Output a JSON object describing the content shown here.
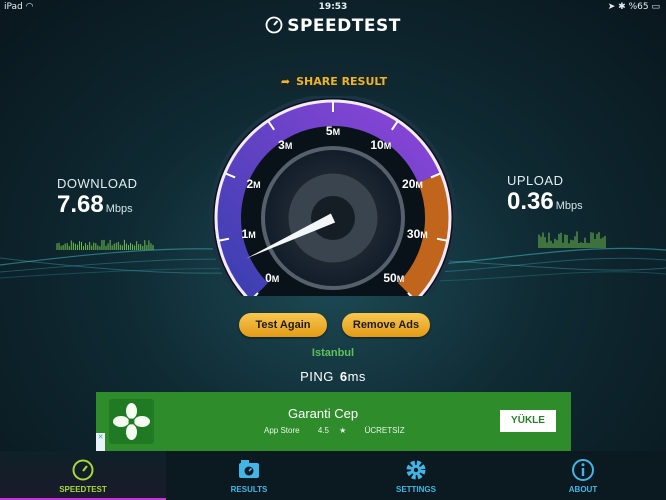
{
  "status_bar": {
    "device": "iPad",
    "time": "19:53",
    "battery": "%65"
  },
  "app": {
    "title": "SPEEDTEST"
  },
  "share": {
    "label": "SHARE RESULT"
  },
  "download": {
    "label": "DOWNLOAD",
    "value": "7.68",
    "unit": "Mbps"
  },
  "upload": {
    "label": "UPLOAD",
    "value": "0.36",
    "unit": "Mbps"
  },
  "gauge": {
    "ticks": [
      {
        "n": "0",
        "u": "M"
      },
      {
        "n": "1",
        "u": "M"
      },
      {
        "n": "2",
        "u": "M"
      },
      {
        "n": "3",
        "u": "M"
      },
      {
        "n": "5",
        "u": "M"
      },
      {
        "n": "10",
        "u": "M"
      },
      {
        "n": "20",
        "u": "M"
      },
      {
        "n": "30",
        "u": "M"
      },
      {
        "n": "50",
        "u": "M"
      }
    ]
  },
  "buttons": {
    "test_again": "Test Again",
    "remove_ads": "Remove Ads"
  },
  "location": "Istanbul",
  "ping": {
    "label": "PING",
    "value": "6",
    "unit": "ms"
  },
  "ad": {
    "title": "Garanti Cep",
    "store": "App Store",
    "rating": "4.5",
    "price": "ÜCRETSİZ",
    "cta": "YÜKLE"
  },
  "tabs": [
    {
      "label": "SPEEDTEST"
    },
    {
      "label": "RESULTS"
    },
    {
      "label": "SETTINGS"
    },
    {
      "label": "ABOUT"
    }
  ],
  "colors": {
    "accent": "#f0b429",
    "active_tab": "#a8d83a",
    "tab": "#41b6e6",
    "gauge_purple": "#7b3fd8",
    "gauge_orange": "#e8821a"
  }
}
